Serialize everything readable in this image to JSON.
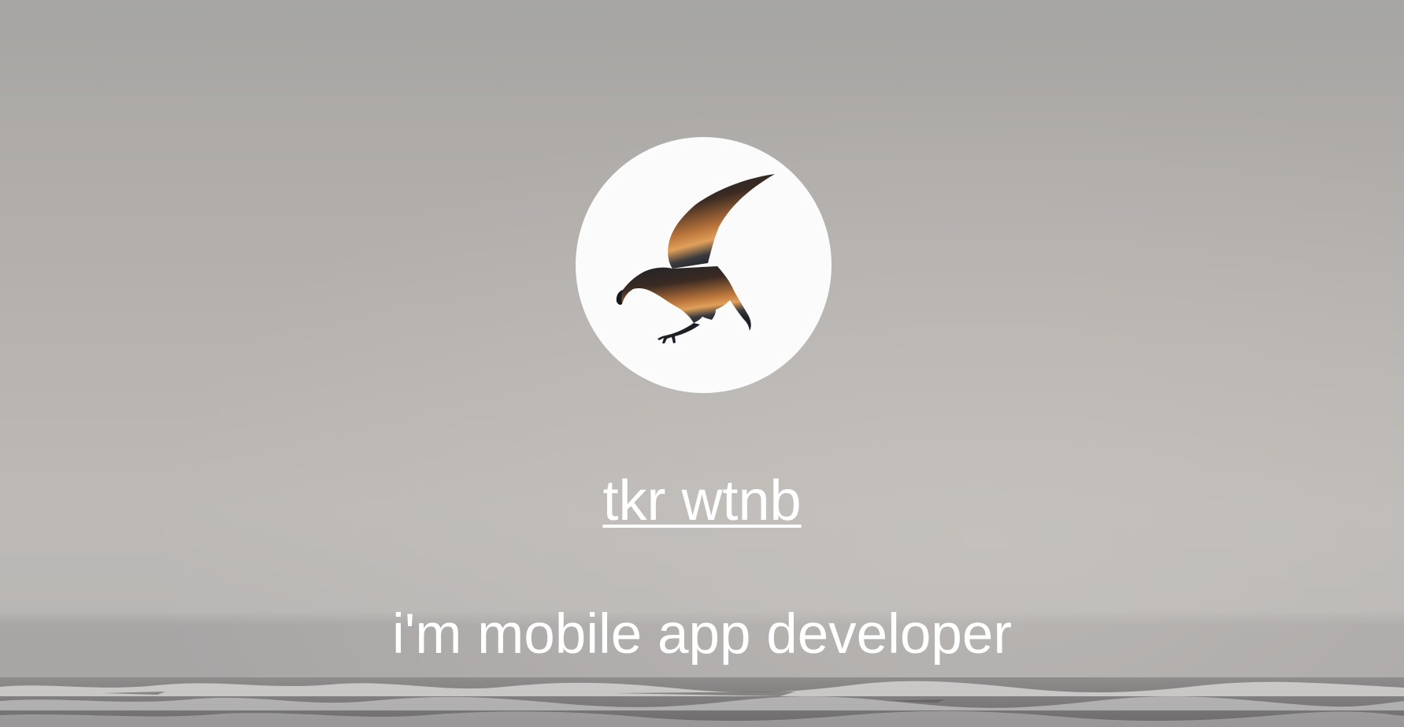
{
  "profile": {
    "name": "tkr wtnb",
    "tagline": "i'm mobile app developer",
    "avatar_icon": "eagle-silhouette-icon"
  },
  "colors": {
    "text": "#ffffff",
    "avatar_bg": "#fbfbfb",
    "sky": "#b6b2af"
  }
}
